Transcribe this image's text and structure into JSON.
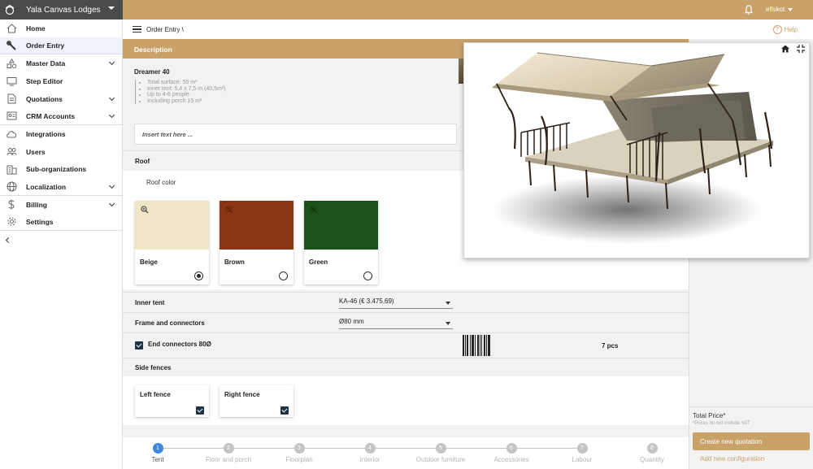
{
  "app": {
    "company": "Yala Canvas Lodges",
    "user": "elfskot"
  },
  "sidebar": {
    "items": [
      {
        "label": "Home",
        "icon": "home-icon"
      },
      {
        "label": "Order Entry",
        "icon": "wrench-icon"
      },
      {
        "label": "Master Data",
        "icon": "shapes-icon"
      },
      {
        "label": "Step Editor",
        "icon": "monitor-icon"
      },
      {
        "label": "Quotations",
        "icon": "document-icon"
      },
      {
        "label": "CRM Accounts",
        "icon": "id-card-icon"
      },
      {
        "label": "Integrations",
        "icon": "cloud-icon"
      },
      {
        "label": "Users",
        "icon": "users-icon"
      },
      {
        "label": "Sub-organizations",
        "icon": "building-icon"
      },
      {
        "label": "Localization",
        "icon": "globe-icon"
      },
      {
        "label": "Billing",
        "icon": "dollar-icon"
      },
      {
        "label": "Settings",
        "icon": "gear-icon"
      }
    ]
  },
  "breadcrumb": {
    "text": "Order Entry \\"
  },
  "help": {
    "label": "Help"
  },
  "description": {
    "header": "Description",
    "product_name": "Dreamer 40",
    "specs": [
      "Total surface: 55 m²",
      "Inner tent: 5,4 x 7,5 m (40,5m²)",
      "Up to 4-6 people",
      "Including porch 15 m²"
    ],
    "note_placeholder": "Insert text here ..."
  },
  "roof": {
    "header": "Roof",
    "subheader": "Roof color",
    "options": [
      {
        "label": "Beige",
        "color": "#f0e5c8",
        "selected": true
      },
      {
        "label": "Brown",
        "color": "#8b3514",
        "selected": false
      },
      {
        "label": "Green",
        "color": "#1b5219",
        "selected": false
      }
    ]
  },
  "inner_tent": {
    "label": "Inner tent",
    "value": "KA-46 (€ 3.475,69)"
  },
  "frame": {
    "label": "Frame and connectors",
    "value": "Ø80 mm"
  },
  "end_connectors": {
    "label": "End connectors 80Ø",
    "checked": true,
    "quantity": "7 pcs"
  },
  "side_fences": {
    "header": "Side fences",
    "options": [
      {
        "label": "Left fence",
        "checked": true
      },
      {
        "label": "Right fence",
        "checked": true
      }
    ]
  },
  "steps": [
    {
      "number": "1",
      "label": "Tent",
      "active": true
    },
    {
      "number": "2",
      "label": "Floor and porch",
      "active": false
    },
    {
      "number": "3",
      "label": "Floorplan",
      "active": false
    },
    {
      "number": "4",
      "label": "Interior",
      "active": false
    },
    {
      "number": "5",
      "label": "Outdoor furniture",
      "active": false
    },
    {
      "number": "6",
      "label": "Accessories",
      "active": false
    },
    {
      "number": "7",
      "label": "Labour",
      "active": false
    },
    {
      "number": "8",
      "label": "Quantity",
      "active": false
    }
  ],
  "summary": {
    "total_label": "Total Price*",
    "vat_note": "*Prices do not include VAT",
    "create_button": "Create new quotation",
    "add_link": "Add new configuration"
  },
  "colors": {
    "accent": "#c9a26a",
    "brand_bar": "#4a4a4a",
    "active_step": "#3a86e0"
  }
}
